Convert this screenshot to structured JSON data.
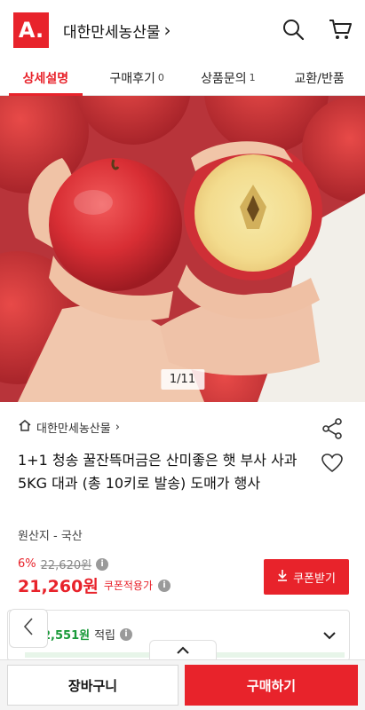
{
  "header": {
    "logo_text": "A.",
    "store_name": "대한만세농산물",
    "chevron": "›",
    "search_icon": "search-icon",
    "cart_icon": "cart-icon"
  },
  "tabs": [
    {
      "label": "상세설명",
      "count": ""
    },
    {
      "label": "구매후기",
      "count": "0"
    },
    {
      "label": "상품문의",
      "count": "1"
    },
    {
      "label": "교환/반품",
      "count": ""
    }
  ],
  "gallery": {
    "counter": "1/11"
  },
  "product": {
    "seller": "대한만세농산물",
    "seller_chevron": "›",
    "title": "1+1 청송 꿀잔뜩머금은 산미좋은 햇 부사 사과 5KG 대과 (총 10키로 발송) 도매가 행사",
    "origin": "원산지 - 국산"
  },
  "price": {
    "discount_pct": "6%",
    "original": "22,620원",
    "final": "21,260원",
    "coupon_note": "쿠폰적용가",
    "info_mark": "i",
    "coupon_button": "쿠폰받기"
  },
  "points": {
    "amount": "2,551원",
    "label": "적립",
    "info_mark": "i"
  },
  "bottom": {
    "cart_label": "장바구니",
    "buy_label": "구매하기"
  },
  "colors": {
    "accent": "#e8232b",
    "points_green": "#1a9a3a"
  }
}
